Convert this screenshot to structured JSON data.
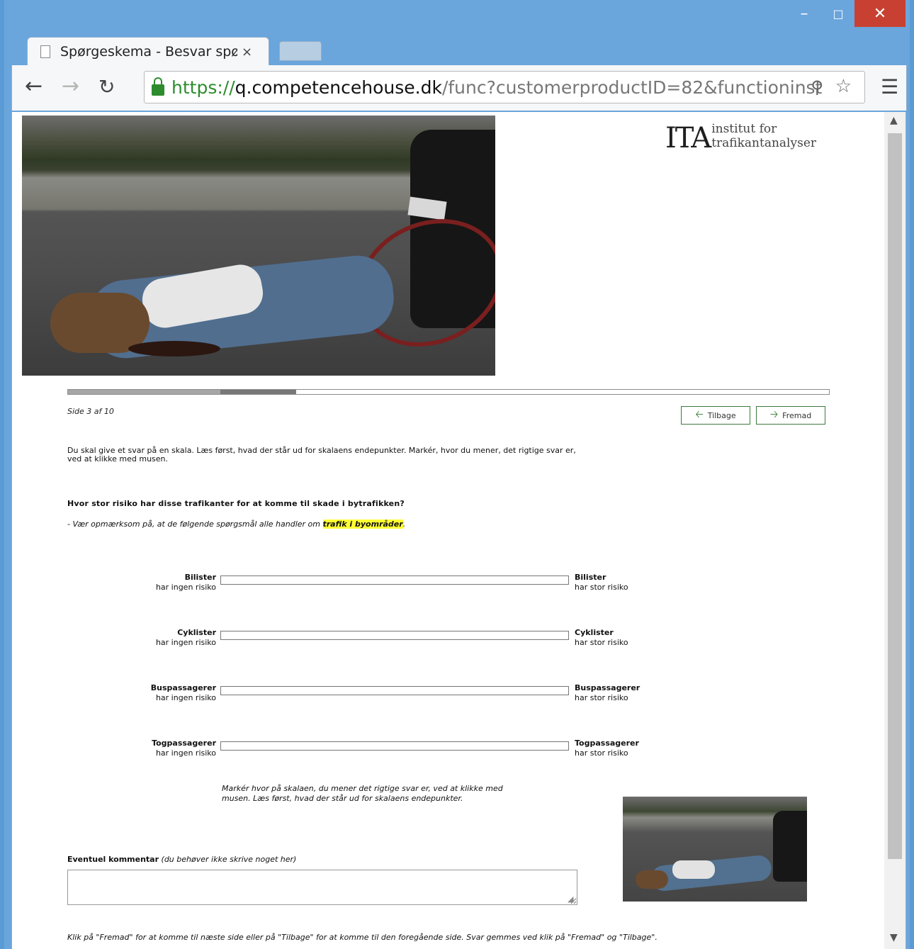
{
  "browser": {
    "tab_title": "Spørgeskema - Besvar spø",
    "tab_close": "×",
    "url_scheme": "https://",
    "url_host": "q.competencehouse.dk",
    "url_path": "/func?customerproductID=82&functioninst",
    "window_min": "–",
    "window_max": "□",
    "window_close": "✕"
  },
  "logo": {
    "mark": "ITA",
    "text": "institut for trafikantanalyser"
  },
  "progress": {
    "current_page": 3,
    "total_pages": 10,
    "label": "Side 3 af 10"
  },
  "nav": {
    "back_label": "Tilbage",
    "forward_label": "Fremad"
  },
  "intro": "Du skal give et svar på en skala. Læs først, hvad der står ud for skalaens endepunkter. Markér, hvor du mener, det rigtige svar er, ved at klikke med musen.",
  "question": "Hvor stor risiko har disse trafikanter for at komme til skade i bytrafikken?",
  "note": {
    "prefix": "- Vær opmærksom på, at de følgende spørgsmål alle handler om ",
    "highlight": "trafik i byområder",
    "suffix": "."
  },
  "scales": [
    {
      "group": "Bilister",
      "left": "har ingen risiko",
      "right": "har stor risiko"
    },
    {
      "group": "Cyklister",
      "left": "har ingen risiko",
      "right": "har stor risiko"
    },
    {
      "group": "Buspassagerer",
      "left": "har ingen risiko",
      "right": "har stor risiko"
    },
    {
      "group": "Togpassagerer",
      "left": "har ingen risiko",
      "right": "har stor risiko"
    }
  ],
  "scale_instruction": "Markér hvor på skalaen, du mener det rigtige svar er, ved at klikke med musen. Læs først, hvad der står ud for skalaens endepunkter.",
  "comment": {
    "label": "Eventuel kommentar",
    "hint": "(du behøver ikke skrive noget her)",
    "value": ""
  },
  "footer": "Klik på \"Fremad\" for at komme til næste side eller på \"Tilbage\" for at komme til den foregående side. Svar gemmes ved klik på \"Fremad\" og \"Tilbage\"."
}
